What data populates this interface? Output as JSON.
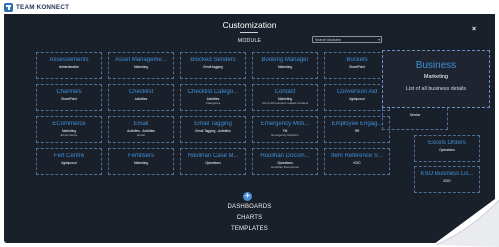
{
  "app": {
    "logo_text": "TEAM KONNECT"
  },
  "header": {
    "title": "Customization",
    "subtitle": "MODULE",
    "search_placeholder": "Search Modules"
  },
  "tiles": [
    {
      "name": "Assessements",
      "sub": "Administrative",
      "sub2": ""
    },
    {
      "name": "Asset Manageme...",
      "sub": "Marketing",
      "sub2": ""
    },
    {
      "name": "Blocked Senders",
      "sub": "Email tagging",
      "sub2": ""
    },
    {
      "name": "Booking Manager",
      "sub": "Marketing",
      "sub2": ""
    },
    {
      "name": "Buckets",
      "sub": "SharePoint",
      "sub2": ""
    },
    {
      "name": "Channels",
      "sub": "SharePoint",
      "sub2": ""
    },
    {
      "name": "Checklist",
      "sub": "Activities",
      "sub2": ""
    },
    {
      "name": "Checklist Catego...",
      "sub": "Activities",
      "sub2": "Categories"
    },
    {
      "name": "Contact",
      "sub": "Marketing",
      "sub2": "List of all business related contacts"
    },
    {
      "name": "Conversion Aid",
      "sub": "Agrisproud",
      "sub2": ""
    },
    {
      "name": "ECommerce",
      "sub": "Marketing",
      "sub2": "ECommerce"
    },
    {
      "name": "Email",
      "sub": "Activities - Activities",
      "sub2": "Email"
    },
    {
      "name": "Email Tagging",
      "sub": "Email Tagging - Activities",
      "sub2": ""
    },
    {
      "name": "Emergency Moti...",
      "sub": "TM",
      "sub2": "Emergency Motilons"
    },
    {
      "name": "Employee Engag...",
      "sub": "HR",
      "sub2": ""
    },
    {
      "name": "Fert Centre",
      "sub": "Agrisproud",
      "sub2": ""
    },
    {
      "name": "Fertilisers",
      "sub": "Marketing",
      "sub2": ""
    },
    {
      "name": "Houlihan Case M...",
      "sub": "Operations",
      "sub2": ""
    },
    {
      "name": "Houlihan Docum...",
      "sub": "Operations",
      "sub2": "Houlihan Documents"
    },
    {
      "name": "Item Reference S...",
      "sub": "KDO",
      "sub2": ""
    }
  ],
  "right_tiles": [
    {
      "name": "Service",
      "sub": "",
      "is_sub_only": true
    },
    {
      "name": "Excels Orders",
      "sub": "Operations"
    },
    {
      "name": "KSO Business Lis...",
      "sub": "KDO"
    }
  ],
  "popover": {
    "title": "Business",
    "sub": "Marketing",
    "desc": "List of all business details"
  },
  "footer": {
    "add_symbol": "+",
    "links": [
      "DASHBOARDS",
      "CHARTS",
      "TEMPLATES"
    ]
  },
  "colors": {
    "panel_bg": "#1a2029",
    "accent": "#3f8fd8",
    "tile_border": "#4d6f99"
  }
}
